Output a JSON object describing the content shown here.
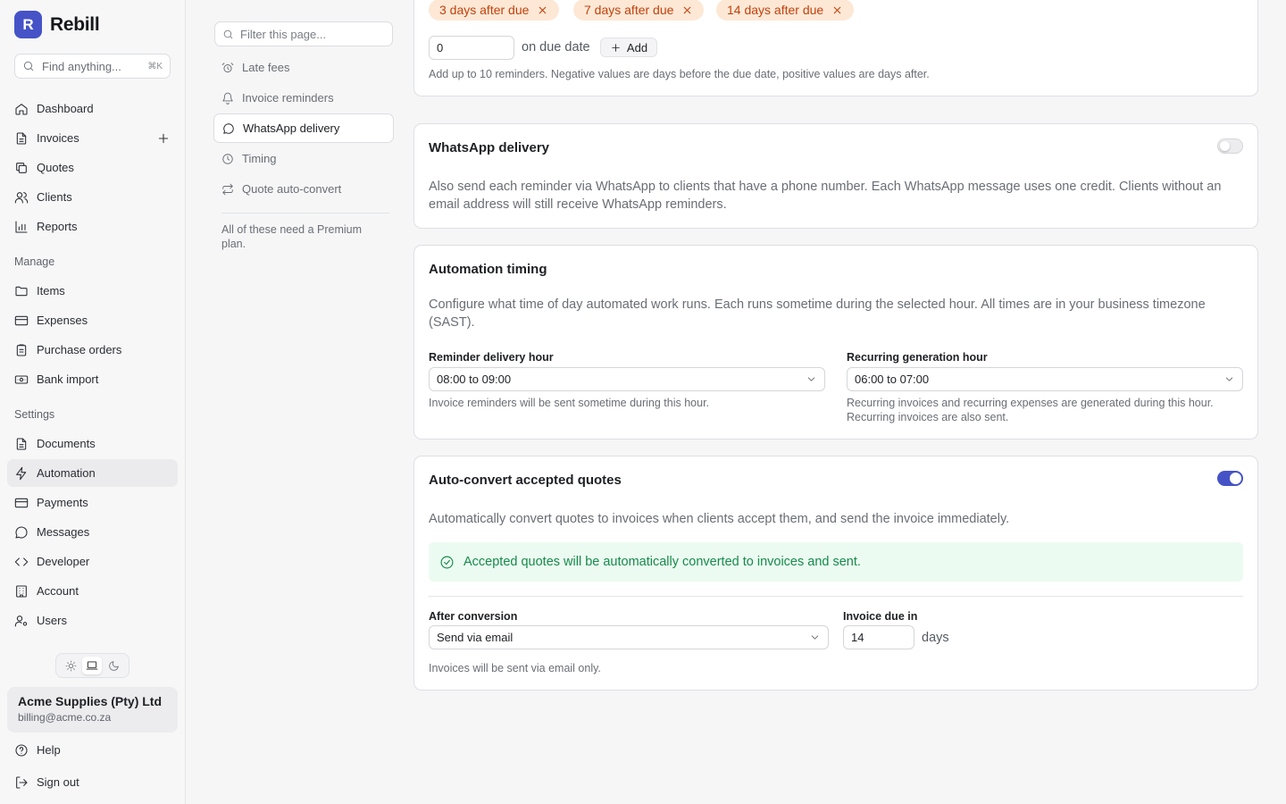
{
  "brand": {
    "initial": "R",
    "name": "Rebill"
  },
  "sidebar": {
    "search_placeholder": "Find anything...",
    "search_shortcut": "⌘K",
    "main_items": [
      {
        "label": "Dashboard",
        "icon": "home-icon"
      },
      {
        "label": "Invoices",
        "icon": "file-text-icon"
      },
      {
        "label": "Quotes",
        "icon": "copy-icon"
      },
      {
        "label": "Clients",
        "icon": "users-icon"
      },
      {
        "label": "Reports",
        "icon": "bar-chart-icon"
      }
    ],
    "manage_label": "Manage",
    "manage_items": [
      {
        "label": "Items",
        "icon": "folder-icon"
      },
      {
        "label": "Expenses",
        "icon": "credit-card-icon"
      },
      {
        "label": "Purchase orders",
        "icon": "clipboard-icon"
      },
      {
        "label": "Bank import",
        "icon": "banknote-icon"
      }
    ],
    "settings_label": "Settings",
    "settings_items": [
      {
        "label": "Documents",
        "icon": "file-text-icon"
      },
      {
        "label": "Automation",
        "icon": "zap-icon"
      },
      {
        "label": "Payments",
        "icon": "credit-card-icon"
      },
      {
        "label": "Messages",
        "icon": "message-circle-icon"
      },
      {
        "label": "Developer",
        "icon": "code-icon"
      },
      {
        "label": "Account",
        "icon": "building-icon"
      },
      {
        "label": "Users",
        "icon": "user-cog-icon"
      }
    ],
    "active_item": "Automation",
    "account": {
      "name": "Acme Supplies (Pty) Ltd",
      "email": "billing@acme.co.za"
    },
    "footer_items": [
      {
        "label": "Help",
        "icon": "help-circle-icon"
      },
      {
        "label": "Sign out",
        "icon": "log-out-icon"
      }
    ]
  },
  "subnav": {
    "filter_placeholder": "Filter this page...",
    "items": [
      {
        "label": "Late fees",
        "icon": "alarm-clock-icon"
      },
      {
        "label": "Invoice reminders",
        "icon": "bell-icon"
      },
      {
        "label": "WhatsApp delivery",
        "icon": "message-circle-icon"
      },
      {
        "label": "Timing",
        "icon": "clock-icon"
      },
      {
        "label": "Quote auto-convert",
        "icon": "repeat-icon"
      }
    ],
    "active": "WhatsApp delivery",
    "note": "All of these need a Premium plan."
  },
  "reminders": {
    "chips": [
      "3 days after due",
      "7 days after due",
      "14 days after due"
    ],
    "input_value": "0",
    "input_label": "on due date",
    "add_label": "Add",
    "help": "Add up to 10 reminders. Negative values are days before the due date, positive values are days after."
  },
  "whatsapp": {
    "title": "WhatsApp delivery",
    "enabled": false,
    "description": "Also send each reminder via WhatsApp to clients that have a phone number. Each WhatsApp message uses one credit. Clients without an email address will still receive WhatsApp reminders."
  },
  "timing": {
    "title": "Automation timing",
    "description": "Configure what time of day automated work runs. Each runs sometime during the selected hour. All times are in your business timezone (SAST).",
    "reminder_label": "Reminder delivery hour",
    "reminder_value": "08:00 to 09:00",
    "reminder_help": "Invoice reminders will be sent sometime during this hour.",
    "recurring_label": "Recurring generation hour",
    "recurring_value": "06:00 to 07:00",
    "recurring_help": "Recurring invoices and recurring expenses are generated during this hour. Recurring invoices are also sent."
  },
  "autoconvert": {
    "title": "Auto-convert accepted quotes",
    "enabled": true,
    "description": "Automatically convert quotes to invoices when clients accept them, and send the invoice immediately.",
    "success": "Accepted quotes will be automatically converted to invoices and sent.",
    "after_label": "After conversion",
    "after_value": "Send via email",
    "due_label": "Invoice due in",
    "due_value": "14",
    "due_suffix": "days",
    "help": "Invoices will be sent via email only."
  },
  "colors": {
    "accent": "#4553c7",
    "chip_bg": "#fde8d6",
    "chip_text": "#c2410c",
    "success_bg": "#ecfbf1",
    "success_text": "#168a4b"
  }
}
